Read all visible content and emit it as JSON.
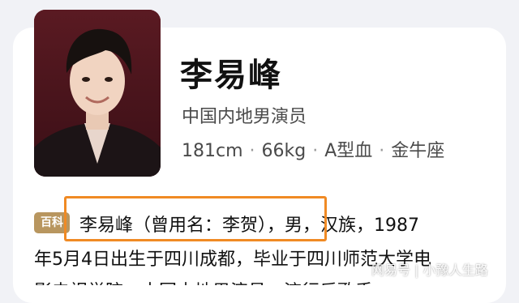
{
  "profile": {
    "name": "李易峰",
    "occupation": "中国内地男演员",
    "stats": {
      "height": "181cm",
      "weight": "66kg",
      "blood_type": "A型血",
      "zodiac": "金牛座",
      "separator": "·"
    },
    "photo_alt": "李易峰"
  },
  "summary": {
    "badge": "百科",
    "line1": "李易峰（曾用名：李贺），男，汉族，1987",
    "line2": "年5月4日出生于四川成都，毕业于四川师范大学电",
    "line3": "影电视学院，中国内地男演员、流行乐歌手。"
  },
  "watermark": "网易号 | 小豫人生路",
  "colors": {
    "badge": "#b8965f",
    "highlight": "#f08a24",
    "name": "#111111"
  }
}
